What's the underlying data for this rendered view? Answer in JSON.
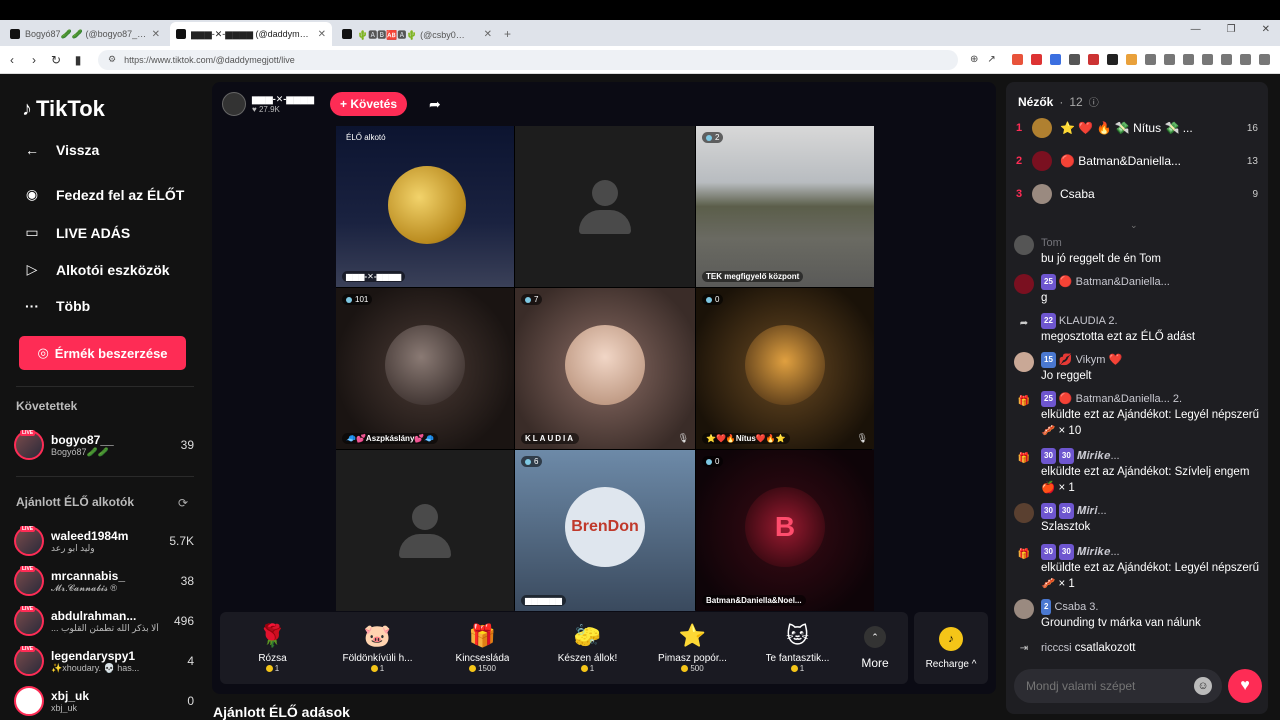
{
  "browser": {
    "tabs": [
      {
        "title": "Bogyó87🥒🥒 (@bogyo87_) É…"
      },
      {
        "title": "▆▆▆-✕-▆▆▆▆ (@daddym…",
        "active": true
      },
      {
        "title": "🌵🅰🅱🆎🅰🌵 (@csby0…"
      }
    ],
    "url": "https://www.tiktok.com/@daddymegjott/live"
  },
  "sidebar": {
    "logo": "TikTok",
    "back": "Vissza",
    "nav": [
      {
        "label": "Fedezd fel az ÉLŐT",
        "icon": "avatar-icon"
      },
      {
        "label": "LIVE ADÁS",
        "icon": "video-camera-icon"
      },
      {
        "label": "Alkotói eszközök",
        "icon": "play-box-icon"
      },
      {
        "label": "Több",
        "icon": "more-dots-icon"
      }
    ],
    "coins_button": "Érmék beszerzése",
    "following_heading": "Követettek",
    "following": [
      {
        "name": "bogyo87__",
        "sub": "Bogyó87🥒🥒",
        "count": "39"
      }
    ],
    "recommended_heading": "Ajánlott ÉLŐ alkotók",
    "recommended": [
      {
        "name": "waleed1984m",
        "sub": "وليد ابو رعد",
        "count": "5.7K"
      },
      {
        "name": "mrcannabis_",
        "sub": "𝓜𝓻.𝓒𝓪𝓷𝓷𝓪𝓫𝓲𝓼 ®",
        "count": "38"
      },
      {
        "name": "abdulrahman...",
        "sub": "... ألا بذكر الله تطمئن القلوب",
        "count": "496"
      },
      {
        "name": "legendaryspy1",
        "sub": "✨xhoudary. 💀 has...",
        "count": "4"
      },
      {
        "name": "xbj_uk",
        "sub": "xbj_uk",
        "count": "0"
      }
    ]
  },
  "stream": {
    "host_name": "▆▆▆-✕-▆▆▆▆",
    "host_likes": "27.9K",
    "follow_label": "+ Követés",
    "cells": [
      {
        "badge": "ÉLŐ alkotó",
        "label": "▆▆▆-✕-▆▆▆▆",
        "type": "moon"
      },
      {
        "badge": "",
        "label": "",
        "type": "placeholder"
      },
      {
        "badge": "2",
        "label": "TEK megfigyelő központ",
        "type": "street"
      },
      {
        "badge": "101",
        "label": "🧢💕Aszpkáslány💕🧢",
        "type": "avatar",
        "color": "#5a4a48"
      },
      {
        "badge": "7",
        "label": "KLAUDIA",
        "type": "avatar",
        "color": "#c9a896"
      },
      {
        "badge": "0",
        "label": "⭐❤️🔥Nítus❤️🔥⭐",
        "type": "avatar",
        "color": "#b07a3a"
      },
      {
        "badge": "",
        "label": "",
        "type": "placeholder"
      },
      {
        "badge": "6",
        "label": "▆▆▆▆▆▆",
        "type": "avatar",
        "color": "#dfe6ee",
        "text": "BrenDon"
      },
      {
        "badge": "0",
        "label": "Batman&Daniella&Noel...",
        "type": "avatar",
        "color": "#7a1020",
        "text": "B"
      }
    ]
  },
  "gifts": [
    {
      "name": "Rózsa",
      "price": "1",
      "icon": "🌹"
    },
    {
      "name": "Földönkívüli h...",
      "price": "1",
      "icon": "🐷"
    },
    {
      "name": "Kincsesláda",
      "price": "1500",
      "icon": "🎁"
    },
    {
      "name": "Készen állok!",
      "price": "1",
      "icon": "🧽"
    },
    {
      "name": "Pimasz popór...",
      "price": "500",
      "icon": "⭐"
    },
    {
      "name": "Te fantasztik...",
      "price": "1",
      "icon": "🐱"
    }
  ],
  "more_label": "More",
  "recharge_label": "Recharge ^",
  "recommended_live_title": "Ajánlott ÉLŐ adások",
  "viewers": {
    "heading": "Nézők",
    "count": "12",
    "top": [
      {
        "rank": "1",
        "name": "⭐ ❤️ 🔥 💸 Nítus 💸 ...",
        "score": "16"
      },
      {
        "rank": "2",
        "name": "🔴 Batman&Daniella...",
        "score": "13"
      },
      {
        "rank": "3",
        "name": "Csaba",
        "score": "9"
      }
    ]
  },
  "chat": [
    {
      "user": "Tom",
      "text": "bu jó reggelt de én Tom",
      "badges": []
    },
    {
      "user": "🔴 Batman&Daniella...",
      "text": "g",
      "badges": [
        "25"
      ]
    },
    {
      "user": "KLAUDIA 2.",
      "text": "megosztotta ezt az ÉLŐ adást",
      "badges": [
        "22"
      ]
    },
    {
      "user": "💋 Vikym ❤️",
      "text": "Jo reggelt",
      "badges": [
        "15"
      ]
    },
    {
      "user": "🔴 Batman&Daniella... 2.",
      "text": "elküldte ezt az Ajándékot: Legyél népszerű 🥓 × 10",
      "badges": [
        "25"
      ]
    },
    {
      "user": "𝑴𝒊𝒓𝒊𝒌𝒆...",
      "text": "elküldte ezt az Ajándékot: Szívlelj engem 🍎 × 1",
      "badges": [
        "30",
        "30"
      ]
    },
    {
      "user": "𝑴𝒊𝒓𝒊...",
      "text": "Szlasztok",
      "badges": [
        "30",
        "30"
      ]
    },
    {
      "user": "𝑴𝒊𝒓𝒊𝒌𝒆...",
      "text": "elküldte ezt az Ajándékot: Legyél népszerű 🥓 × 1",
      "badges": [
        "30",
        "30"
      ]
    },
    {
      "user": "Csaba 3.",
      "text": "Grounding tv márka van nálunk",
      "badges": [
        "2"
      ]
    },
    {
      "user": "ricccsi",
      "text": "csatlakozott",
      "badges": []
    }
  ],
  "chat_placeholder": "Mondj valami szépet"
}
